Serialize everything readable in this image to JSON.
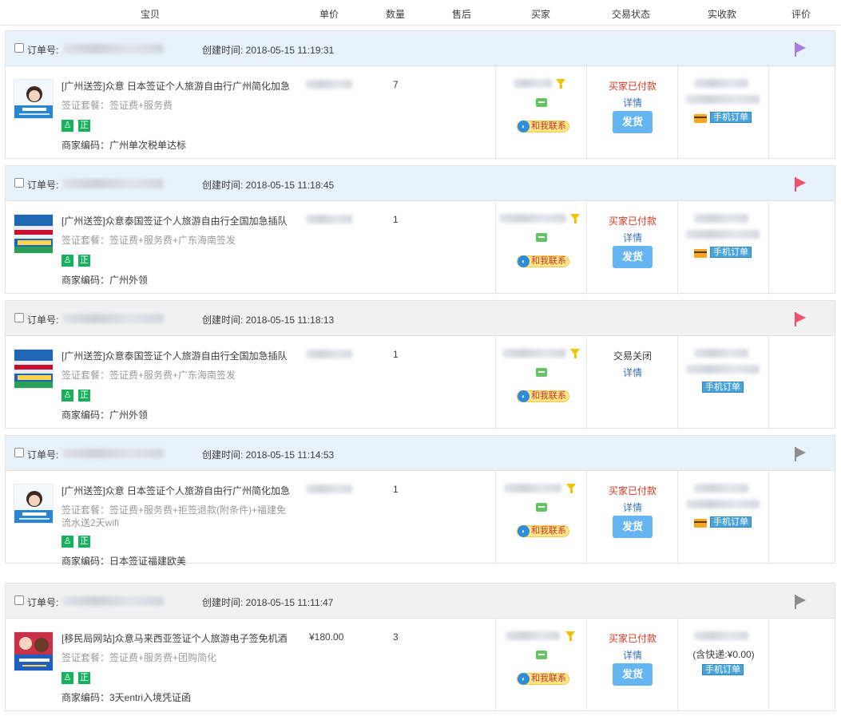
{
  "header": {
    "col_item": "宝贝",
    "col_price": "单价",
    "col_qty": "数量",
    "col_aftersale": "售后",
    "col_buyer": "买家",
    "col_status": "交易状态",
    "col_paid": "实收款",
    "col_review": "评价"
  },
  "labels": {
    "order_no": "订单号:",
    "created_prefix": "创建时间: ",
    "contact": "和我联系",
    "detail": "详情",
    "ship": "发货",
    "mobile_order": "手机订单",
    "badge_zheng": "正"
  },
  "colors": {
    "flag_purple": "#a77de0",
    "flag_red": "#f0506e",
    "flag_gray": "#8c8c8c",
    "status_paid": "#d9381e"
  },
  "orders": [
    {
      "created": "2018-05-15 11:19:31",
      "title": "[广州送签]众意 日本签证个人旅游自由行广州简化加急",
      "package": "签证套餐：签证费+服务费",
      "code": "商家编码：广州单次税单达标",
      "price": "",
      "qty": "7",
      "status": "买家已付款",
      "paid_note": "",
      "flag": "purple-flag-icon",
      "thumb": "japan-visa-thumb"
    },
    {
      "created": "2018-05-15 11:18:45",
      "title": "[广州送签]众意泰国签证个人旅游自由行全国加急插队",
      "package": "签证套餐：签证费+服务费+广东海南签发",
      "code": "商家编码：广州外领",
      "price": "",
      "qty": "1",
      "status": "买家已付款",
      "paid_note": "",
      "flag": "red-flag-icon",
      "thumb": "thailand-visa-thumb"
    },
    {
      "created": "2018-05-15 11:18:13",
      "title": "[广州送签]众意泰国签证个人旅游自由行全国加急插队",
      "package": "签证套餐：签证费+服务费+广东海南签发",
      "code": "商家编码：广州外领",
      "price": "",
      "qty": "1",
      "status": "交易关闭",
      "paid_note": "",
      "flag": "red-flag-icon",
      "thumb": "thailand-visa-thumb"
    },
    {
      "created": "2018-05-15 11:14:53",
      "title": "[广州送签]众意 日本签证个人旅游自由行广州简化加急",
      "package": "签证套餐：签证费+服务费+拒签退款(附条件)+福建免流水送2天wifi",
      "code": "商家编码：日本签证福建欧美",
      "price": "",
      "qty": "1",
      "status": "买家已付款",
      "paid_note": "",
      "flag": "gray-flag-icon",
      "thumb": "japan-visa-thumb"
    },
    {
      "created": "2018-05-15 11:11:47",
      "title": "[移民局网站]众意马来西亚签证个人旅游电子签免机酒",
      "package": "签证套餐：签证费+服务费+团购简化",
      "code": "商家编码：3天entri入境凭证函",
      "price": "¥180.00",
      "qty": "3",
      "status": "买家已付款",
      "paid_note": "(含快递:¥0.00)",
      "flag": "gray-flag-icon",
      "thumb": "malaysia-visa-thumb"
    }
  ]
}
